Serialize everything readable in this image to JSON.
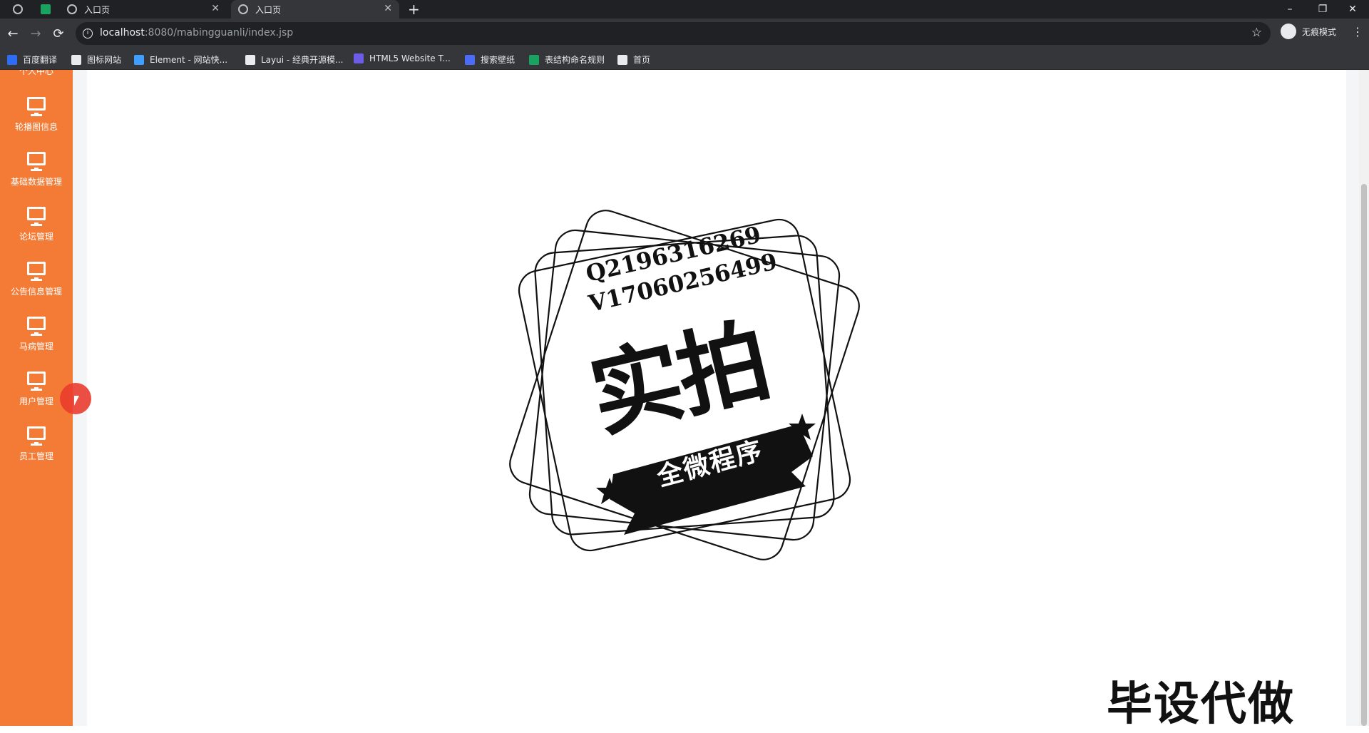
{
  "browser": {
    "tabs": [
      {
        "title": "入口页",
        "active": false
      },
      {
        "title": "入口页",
        "active": true
      }
    ],
    "new_tab": "+",
    "tab_close": "✕",
    "window_controls": {
      "minimize": "–",
      "restore": "❐",
      "close": "✕"
    },
    "nav": {
      "back": "←",
      "forward": "→",
      "reload": "⟳"
    },
    "address": {
      "host": "localhost",
      "rest": ":8080/mabingguanli/index.jsp"
    },
    "bookmark_star": "☆",
    "incognito_label": "无痕模式",
    "menu_glyph": "⋮",
    "bookmarks": [
      {
        "label": "百度翻译",
        "color": "#2d6df6"
      },
      {
        "label": "图标网站",
        "color": "#e8eaed"
      },
      {
        "label": "Element - 网站快...",
        "color": "#409eff"
      },
      {
        "label": "Layui - 经典开源模...",
        "color": "#e8eaed"
      },
      {
        "label": "HTML5 Website T...",
        "color": "#6c5ce7"
      },
      {
        "label": "搜索壁纸",
        "color": "#4a6cf7"
      },
      {
        "label": "表结构命名规则",
        "color": "#1aa260"
      },
      {
        "label": "首页",
        "color": "#e8eaed"
      }
    ]
  },
  "sidebar": {
    "partial_item": "个人中心",
    "items": [
      {
        "label": "轮播图信息"
      },
      {
        "label": "基础数据管理"
      },
      {
        "label": "论坛管理"
      },
      {
        "label": "公告信息管理"
      },
      {
        "label": "马病管理"
      },
      {
        "label": "用户管理"
      },
      {
        "label": "员工管理"
      }
    ],
    "accent_color": "#f47b35"
  },
  "overlay": {
    "stamp_qq": "Q2196316269",
    "stamp_wechat": "V17060256499",
    "stamp_main": "实拍",
    "stamp_banner": "全微程序",
    "corner_text": "毕设代做"
  }
}
